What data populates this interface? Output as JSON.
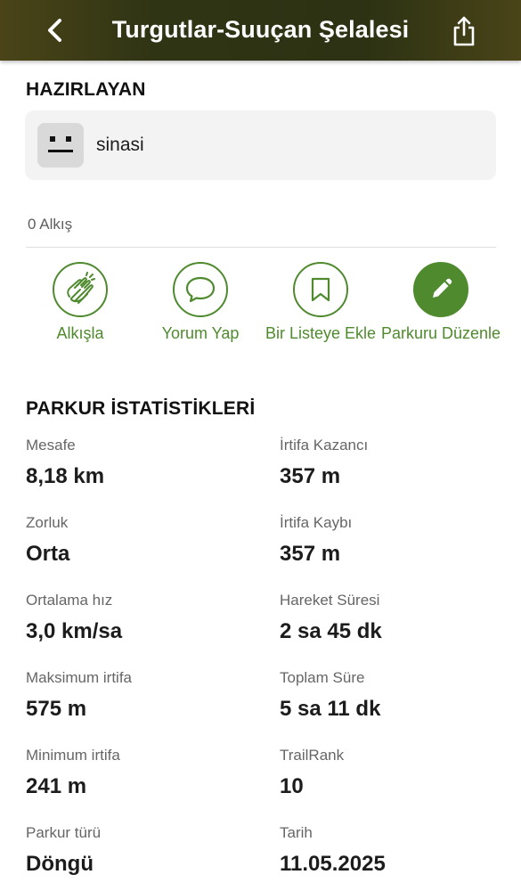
{
  "header": {
    "title": "Turgutlar-Suuçan Şelalesi"
  },
  "author_section": {
    "title": "HAZIRLAYAN",
    "author_name": "sinasi"
  },
  "claps_text": "0 Alkış",
  "actions": [
    {
      "label": "Alkışla",
      "icon": "clap-icon"
    },
    {
      "label": "Yorum Yap",
      "icon": "comment-icon"
    },
    {
      "label": "Bir Listeye Ekle",
      "icon": "bookmark-icon"
    },
    {
      "label": "Parkuru Düzenle",
      "icon": "pencil-icon"
    }
  ],
  "colors": {
    "accent": "#4f8a2e",
    "header_bg": "#2f3414"
  },
  "stats": {
    "title": "PARKUR İSTATİSTİKLERİ",
    "left": [
      {
        "label": "Mesafe",
        "value": "8,18 km"
      },
      {
        "label": "Zorluk",
        "value": "Orta"
      },
      {
        "label": "Ortalama hız",
        "value": "3,0 km/sa"
      },
      {
        "label": "Maksimum irtifa",
        "value": "575 m"
      },
      {
        "label": "Minimum irtifa",
        "value": "241 m"
      },
      {
        "label": "Parkur türü",
        "value": "Döngü"
      }
    ],
    "right": [
      {
        "label": "İrtifa Kazancı",
        "value": "357 m"
      },
      {
        "label": "İrtifa Kaybı",
        "value": "357 m"
      },
      {
        "label": "Hareket Süresi",
        "value": "2 sa 45 dk"
      },
      {
        "label": "Toplam Süre",
        "value": "5 sa 11 dk"
      },
      {
        "label": "TrailRank",
        "value": "10"
      },
      {
        "label": "Tarih",
        "value": "11.05.2025"
      }
    ]
  }
}
